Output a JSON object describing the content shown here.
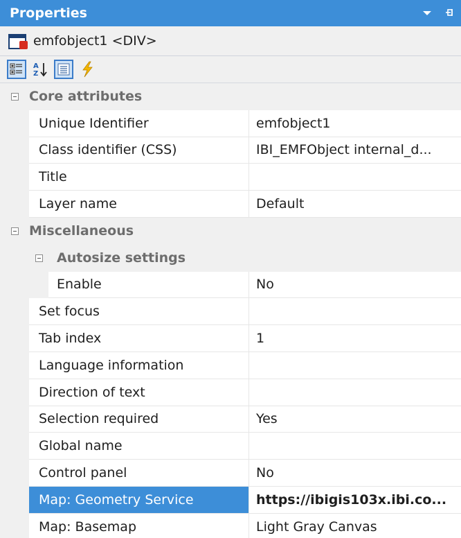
{
  "panel": {
    "title": "Properties",
    "object": "emfobject1 <DIV>"
  },
  "toolbar": {
    "buttons": [
      "categorized-icon",
      "alphabetical-icon",
      "properties-icon",
      "events-icon"
    ]
  },
  "grid": {
    "core_attributes": {
      "label": "Core attributes",
      "rows": [
        {
          "name": "Unique Identifier",
          "value": "emfobject1"
        },
        {
          "name": "Class identifier (CSS)",
          "value": "IBI_EMFObject internal_d..."
        },
        {
          "name": "Title",
          "value": ""
        },
        {
          "name": "Layer name",
          "value": "Default"
        }
      ]
    },
    "miscellaneous": {
      "label": "Miscellaneous",
      "autosize": {
        "label": "Autosize settings",
        "rows": [
          {
            "name": "Enable",
            "value": "No"
          }
        ]
      },
      "rows": [
        {
          "name": "Set focus",
          "value": ""
        },
        {
          "name": "Tab index",
          "value": "1"
        },
        {
          "name": "Language information",
          "value": ""
        },
        {
          "name": "Direction of text",
          "value": ""
        },
        {
          "name": "Selection required",
          "value": "Yes"
        },
        {
          "name": "Global name",
          "value": ""
        },
        {
          "name": "Control panel",
          "value": "No"
        },
        {
          "name": "Map: Geometry Service",
          "value": "https://ibigis103x.ibi.co..."
        },
        {
          "name": "Map: Basemap",
          "value": "Light Gray Canvas"
        }
      ]
    }
  },
  "colors": {
    "accent": "#3d8ed8",
    "category_text": "#6d6d6d"
  }
}
